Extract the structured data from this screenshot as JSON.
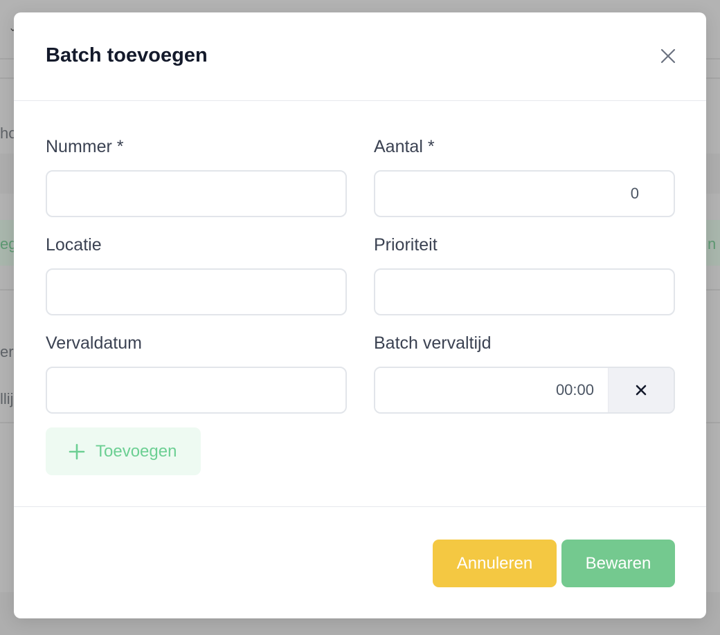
{
  "background": {
    "fragments": [
      "ho",
      "eg",
      "n",
      "ers",
      "llij"
    ]
  },
  "modal": {
    "title": "Batch toevoegen",
    "close_icon": "close-icon"
  },
  "form": {
    "nummer": {
      "label": "Nummer *",
      "value": ""
    },
    "aantal": {
      "label": "Aantal *",
      "value": "0"
    },
    "locatie": {
      "label": "Locatie",
      "value": ""
    },
    "prioriteit": {
      "label": "Prioriteit",
      "value": ""
    },
    "vervaldatum": {
      "label": "Vervaldatum",
      "value": ""
    },
    "batch_vervaltijd": {
      "label": "Batch vervaltijd",
      "value": "00:00",
      "clear_icon": "clear-icon"
    }
  },
  "add_button": {
    "label": "Toevoegen",
    "icon": "plus-icon"
  },
  "footer": {
    "cancel_label": "Annuleren",
    "save_label": "Bewaren"
  },
  "colors": {
    "cancel": "#f4c842",
    "save": "#74c98f",
    "add_text": "#6ccf93",
    "add_bg": "#eefaf2"
  }
}
